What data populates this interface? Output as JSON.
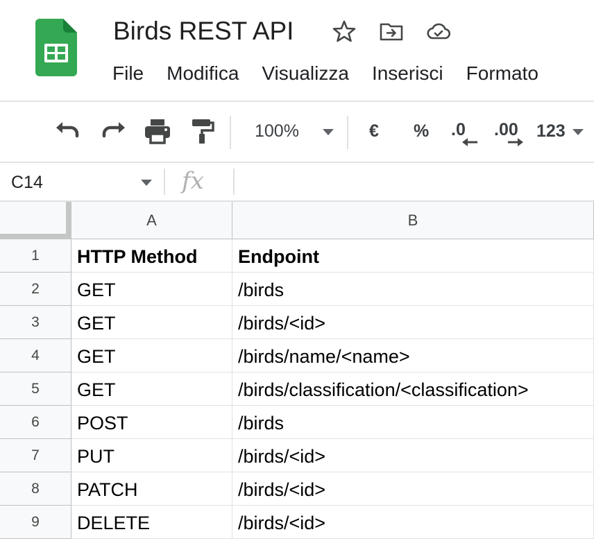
{
  "app": {
    "doc_title": "Birds REST API",
    "icons": {
      "logo": "sheets-logo-icon",
      "star": "star-icon",
      "move": "move-to-folder-icon",
      "cloud": "cloud-saved-icon"
    },
    "brand_color": "#34a853"
  },
  "menu": {
    "items": [
      {
        "label": "File"
      },
      {
        "label": "Modifica"
      },
      {
        "label": "Visualizza"
      },
      {
        "label": "Inserisci"
      },
      {
        "label": "Formato"
      }
    ]
  },
  "toolbar": {
    "zoom": "100%",
    "currency": "€",
    "percent": "%",
    "decrease_decimals": ".0",
    "increase_decimals": ".00",
    "number_format": "123",
    "icons": [
      "undo-icon",
      "redo-icon",
      "print-icon",
      "paint-format-icon"
    ]
  },
  "formula_bar": {
    "cell_ref": "C14",
    "fx_label": "fx",
    "value": ""
  },
  "grid": {
    "columns": [
      "A",
      "B"
    ],
    "rows": [
      {
        "num": "1",
        "a": "HTTP Method",
        "b": "Endpoint"
      },
      {
        "num": "2",
        "a": "GET",
        "b": "/birds"
      },
      {
        "num": "3",
        "a": "GET",
        "b": "/birds/<id>"
      },
      {
        "num": "4",
        "a": "GET",
        "b": "/birds/name/<name>"
      },
      {
        "num": "5",
        "a": "GET",
        "b": "/birds/classification/<classification>"
      },
      {
        "num": "6",
        "a": "POST",
        "b": "/birds"
      },
      {
        "num": "7",
        "a": "PUT",
        "b": "/birds/<id>"
      },
      {
        "num": "8",
        "a": "PATCH",
        "b": "/birds/<id>"
      },
      {
        "num": "9",
        "a": "DELETE",
        "b": "/birds/<id>"
      }
    ]
  }
}
